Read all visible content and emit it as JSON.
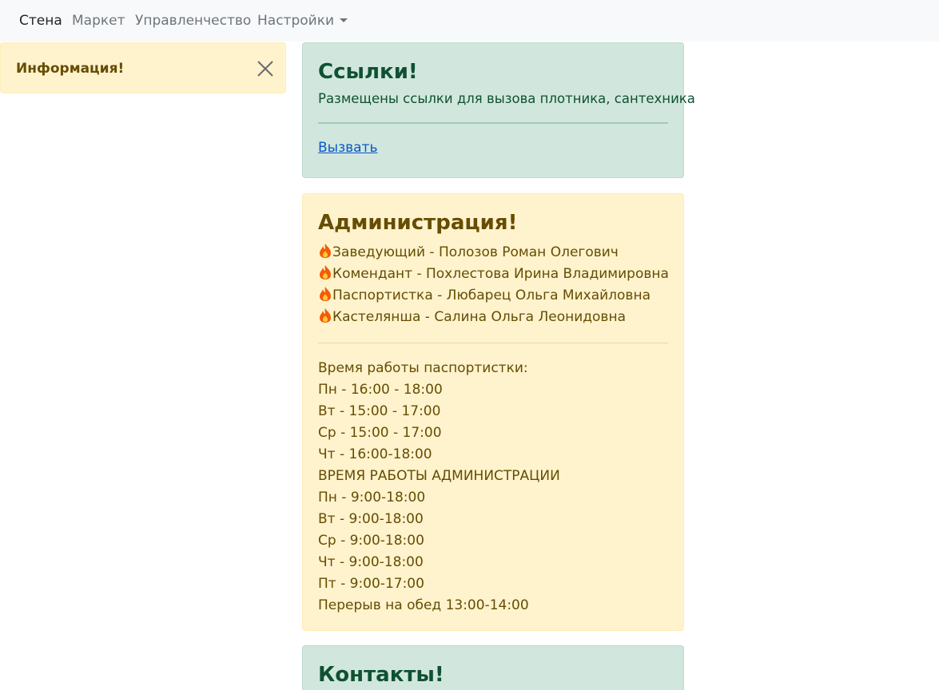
{
  "nav": {
    "items": [
      "Стена",
      "Маркет",
      "Управленчество",
      "Настройки"
    ]
  },
  "info_alert": {
    "title": "Информация!"
  },
  "links_card": {
    "title": "Ссылки!",
    "text": "Размещены ссылки для вызова плотника, сантехника",
    "link_label": "Вызвать"
  },
  "admin_card": {
    "title": "Администрация!",
    "staff": [
      "Заведующий - Полозов Роман Олегович",
      "Комендант - Похлестова Ирина Владимировна",
      "Паспортистка - Любарец Ольга Михайловна",
      "Кастелянша - Салина Ольга Леонидовна"
    ],
    "schedule": [
      "Время работы паспортистки:",
      "Пн - 16:00 - 18:00",
      "Вт - 15:00 - 17:00",
      "Ср - 15:00 - 17:00",
      "Чт - 16:00-18:00",
      "ВРЕМЯ РАБОТЫ АДМИНИСТРАЦИИ",
      "Пн - 9:00-18:00",
      "Вт - 9:00-18:00",
      "Ср - 9:00-18:00",
      "Чт - 9:00-18:00",
      "Пт - 9:00-17:00",
      "Перерыв на обед 13:00-14:00"
    ]
  },
  "contacts_card": {
    "title": "Контакты!"
  },
  "icons": {
    "staff_marker": "fire-icon",
    "close": "close-icon",
    "dropdown": "chevron-down-icon"
  }
}
